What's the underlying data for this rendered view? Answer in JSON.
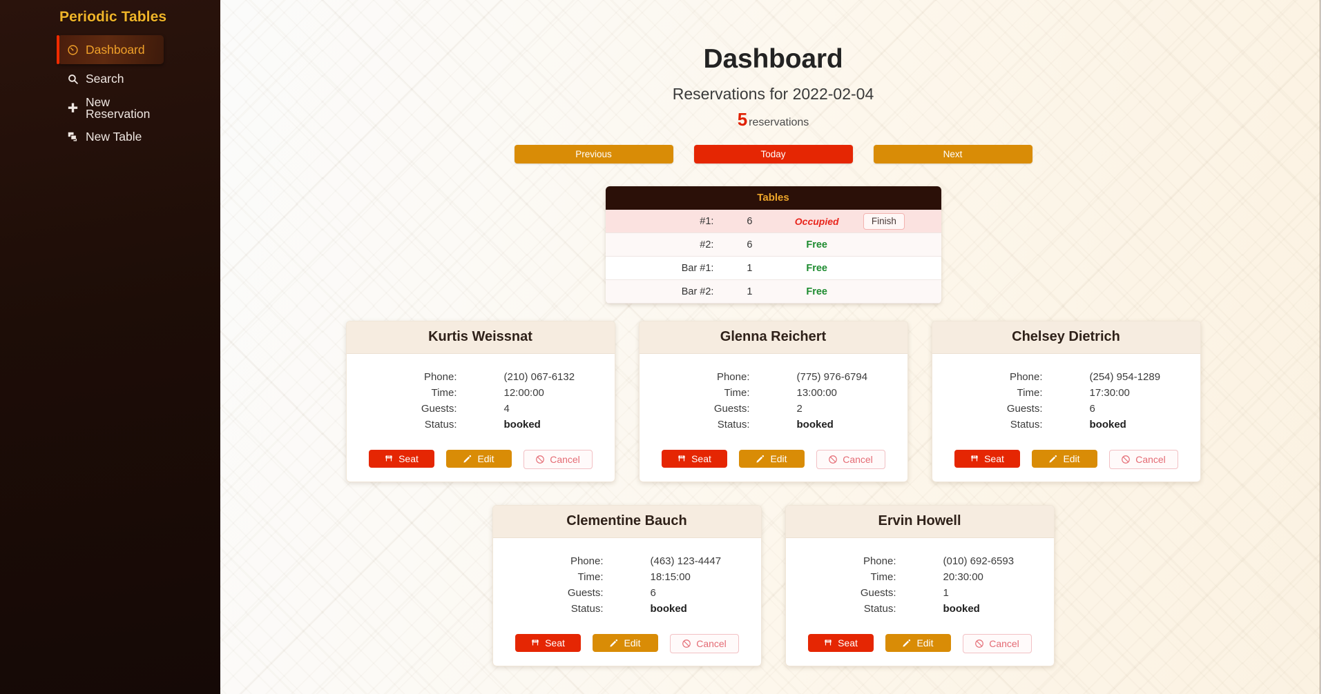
{
  "sidebar": {
    "brand": "Periodic Tables",
    "items": [
      {
        "label": "Dashboard",
        "icon": "dashboard-icon",
        "active": true
      },
      {
        "label": "Search",
        "icon": "search-icon",
        "active": false
      },
      {
        "label": "New Reservation",
        "icon": "plus-icon",
        "active": false
      },
      {
        "label": "New Table",
        "icon": "new-table-icon",
        "active": false
      }
    ],
    "colors": {
      "bg": "#1d0d07",
      "brand_text": "#f0b429",
      "active_bar": "#ef2b00",
      "active_text": "#f0a029"
    }
  },
  "header": {
    "title": "Dashboard",
    "subtitle": "Reservations for 2022-02-04",
    "date": "2022-02-04",
    "count": "5",
    "count_word": "reservations"
  },
  "day_nav": {
    "previous_label": "Previous",
    "today_label": "Today",
    "next_label": "Next",
    "colors": {
      "orange": "#d98c06",
      "red": "#e52603"
    }
  },
  "tables_panel": {
    "title": "Tables",
    "finish_label": "Finish",
    "rows": [
      {
        "name": "#1:",
        "capacity": "6",
        "status": "Occupied",
        "occupied": true,
        "has_finish": true
      },
      {
        "name": "#2:",
        "capacity": "6",
        "status": "Free",
        "occupied": false,
        "has_finish": false
      },
      {
        "name": "Bar #1:",
        "capacity": "1",
        "status": "Free",
        "occupied": false,
        "has_finish": false
      },
      {
        "name": "Bar #2:",
        "capacity": "1",
        "status": "Free",
        "occupied": false,
        "has_finish": false
      }
    ],
    "colors": {
      "header_bg": "#2b1008",
      "header_text": "#eda52a",
      "occupied": "#e8251c",
      "free": "#1d8b2f"
    }
  },
  "card_labels": {
    "phone": "Phone:",
    "time": "Time:",
    "guests": "Guests:",
    "status": "Status:",
    "seat": "Seat",
    "edit": "Edit",
    "cancel": "Cancel"
  },
  "reservations": [
    {
      "name": "Kurtis Weissnat",
      "phone": "(210) 067-6132",
      "time": "12:00:00",
      "guests": "4",
      "status": "booked"
    },
    {
      "name": "Glenna Reichert",
      "phone": "(775) 976-6794",
      "time": "13:00:00",
      "guests": "2",
      "status": "booked"
    },
    {
      "name": "Chelsey Dietrich",
      "phone": "(254) 954-1289",
      "time": "17:30:00",
      "guests": "6",
      "status": "booked"
    },
    {
      "name": "Clementine Bauch",
      "phone": "(463) 123-4447",
      "time": "18:15:00",
      "guests": "6",
      "status": "booked"
    },
    {
      "name": "Ervin Howell",
      "phone": "(010) 692-6593",
      "time": "20:30:00",
      "guests": "1",
      "status": "booked"
    }
  ]
}
